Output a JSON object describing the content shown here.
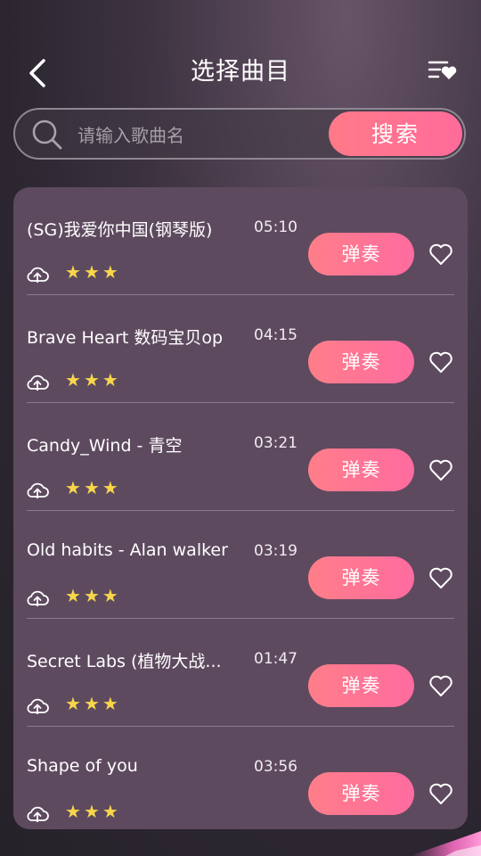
{
  "header": {
    "title": "选择曲目",
    "back_icon": "chevron-left-icon",
    "favorites_icon": "favorite-list-icon"
  },
  "search": {
    "placeholder": "请输入歌曲名",
    "value": "",
    "button_label": "搜索"
  },
  "songs": [
    {
      "name": "(SG)我爱你中国(钢琴版)",
      "duration": "05:10",
      "rating": 3,
      "play_label": "弹奏"
    },
    {
      "name": "Brave Heart 数码宝贝op",
      "duration": "04:15",
      "rating": 3,
      "play_label": "弹奏"
    },
    {
      "name": "Candy_Wind - 青空",
      "duration": "03:21",
      "rating": 3,
      "play_label": "弹奏"
    },
    {
      "name": "Old habits - Alan walker",
      "duration": "03:19",
      "rating": 3,
      "play_label": "弹奏"
    },
    {
      "name": "Secret Labs (植物大战...",
      "duration": "01:47",
      "rating": 3,
      "play_label": "弹奏"
    },
    {
      "name": "Shape of you",
      "duration": "03:56",
      "rating": 3,
      "play_label": "弹奏"
    }
  ],
  "colors": {
    "accent_start": "#ff7e89",
    "accent_end": "#ff6ba0",
    "card_bg": "#5e4a5f",
    "star": "#f7d64a"
  }
}
